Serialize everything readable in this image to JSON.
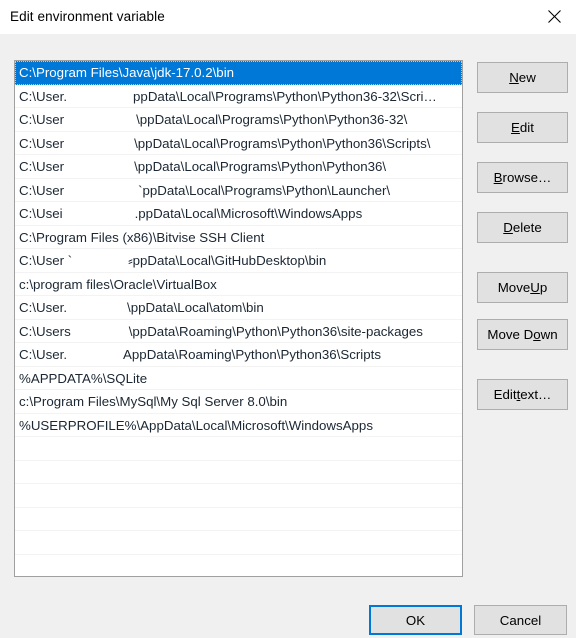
{
  "window": {
    "title": "Edit environment variable",
    "close_icon": "close-icon"
  },
  "colors": {
    "selection": "#0078D7",
    "dialog_bg": "#F0F0F0",
    "button_bg": "#E1E1E1",
    "button_border": "#ADADAD",
    "list_bg": "#FFFFFF",
    "focus_ring": "#0078D7"
  },
  "list": {
    "selected_index": 0,
    "visible_empty_rows": 6,
    "entries": [
      {
        "prefix": "C:\\Program Files\\Java\\jdk-17.0.2\\bin",
        "redacted_width": 0,
        "suffix": "",
        "selected": true
      },
      {
        "prefix": "C:\\User.",
        "redacted_width": 66,
        "suffix": "ppData\\Local\\Programs\\Python\\Python36-32\\Scri…",
        "selected": false
      },
      {
        "prefix": "C:\\User",
        "redacted_width": 72,
        "suffix": "\\ppData\\Local\\Programs\\Python\\Python36-32\\",
        "selected": false
      },
      {
        "prefix": "C:\\User",
        "redacted_width": 70,
        "suffix": "\\ppData\\Local\\Programs\\Python\\Python36\\Scripts\\",
        "selected": false
      },
      {
        "prefix": "C:\\User",
        "redacted_width": 70,
        "suffix": "\\ppData\\Local\\Programs\\Python\\Python36\\",
        "selected": false
      },
      {
        "prefix": "C:\\User",
        "redacted_width": 74,
        "suffix": "`ppData\\Local\\Programs\\Python\\Launcher\\",
        "selected": false
      },
      {
        "prefix": "C:\\Usei",
        "redacted_width": 72,
        "suffix": ".ppData\\Local\\Microsoft\\WindowsApps",
        "selected": false
      },
      {
        "prefix": "C:\\Program Files (x86)\\Bitvise SSH Client",
        "redacted_width": 0,
        "suffix": "",
        "selected": false
      },
      {
        "prefix": "C:\\User `",
        "redacted_width": 56,
        "suffix": "⸗ppData\\Local\\GitHubDesktop\\bin",
        "selected": false
      },
      {
        "prefix": "c:\\program files\\Oracle\\VirtualBox",
        "redacted_width": 0,
        "suffix": "",
        "selected": false
      },
      {
        "prefix": "C:\\User.",
        "redacted_width": 60,
        "suffix": "\\ppData\\Local\\atom\\bin",
        "selected": false
      },
      {
        "prefix": "C:\\Users",
        "redacted_width": 58,
        "suffix": "\\ppData\\Roaming\\Python\\Python36\\site-packages",
        "selected": false
      },
      {
        "prefix": "C:\\User.",
        "redacted_width": 56,
        "suffix": "AppData\\Roaming\\Python\\Python36\\Scripts",
        "selected": false
      },
      {
        "prefix": "%APPDATA%\\SQLite",
        "redacted_width": 0,
        "suffix": "",
        "selected": false
      },
      {
        "prefix": "c:\\Program Files\\MySql\\My Sql Server 8.0\\bin",
        "redacted_width": 0,
        "suffix": "",
        "selected": false
      },
      {
        "prefix": "%USERPROFILE%\\AppData\\Local\\Microsoft\\WindowsApps",
        "redacted_width": 0,
        "suffix": "",
        "selected": false
      }
    ]
  },
  "side_buttons": {
    "new": {
      "before": "",
      "accel": "N",
      "after": "ew"
    },
    "edit": {
      "before": "",
      "accel": "E",
      "after": "dit"
    },
    "browse": {
      "before": "",
      "accel": "B",
      "after": "rowse…"
    },
    "delete": {
      "before": "",
      "accel": "D",
      "after": "elete"
    },
    "move_up": {
      "before": "Move ",
      "accel": "U",
      "after": "p"
    },
    "move_down": {
      "before": "Move D",
      "accel": "o",
      "after": "wn"
    },
    "edit_text": {
      "before": "Edit ",
      "accel": "t",
      "after": "ext…"
    }
  },
  "bottom_buttons": {
    "ok": "OK",
    "cancel": "Cancel"
  }
}
